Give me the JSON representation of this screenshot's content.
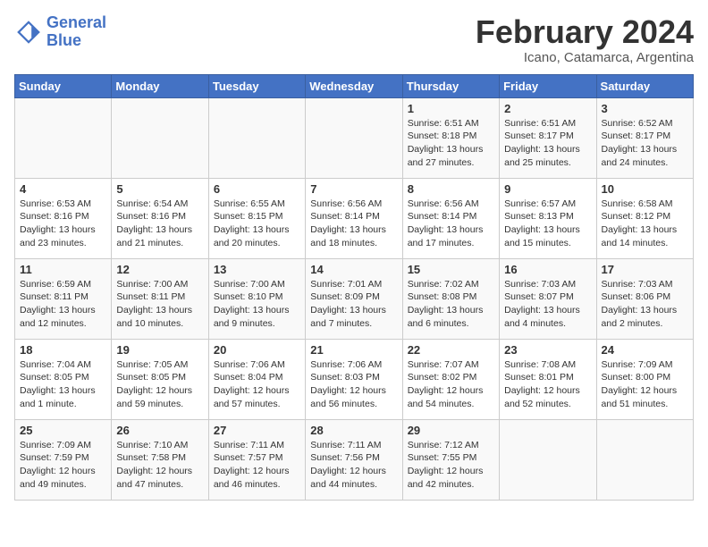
{
  "logo": {
    "line1": "General",
    "line2": "Blue"
  },
  "title": "February 2024",
  "subtitle": "Icano, Catamarca, Argentina",
  "days_of_week": [
    "Sunday",
    "Monday",
    "Tuesday",
    "Wednesday",
    "Thursday",
    "Friday",
    "Saturday"
  ],
  "weeks": [
    [
      {
        "day": "",
        "info": ""
      },
      {
        "day": "",
        "info": ""
      },
      {
        "day": "",
        "info": ""
      },
      {
        "day": "",
        "info": ""
      },
      {
        "day": "1",
        "info": "Sunrise: 6:51 AM\nSunset: 8:18 PM\nDaylight: 13 hours and 27 minutes."
      },
      {
        "day": "2",
        "info": "Sunrise: 6:51 AM\nSunset: 8:17 PM\nDaylight: 13 hours and 25 minutes."
      },
      {
        "day": "3",
        "info": "Sunrise: 6:52 AM\nSunset: 8:17 PM\nDaylight: 13 hours and 24 minutes."
      }
    ],
    [
      {
        "day": "4",
        "info": "Sunrise: 6:53 AM\nSunset: 8:16 PM\nDaylight: 13 hours and 23 minutes."
      },
      {
        "day": "5",
        "info": "Sunrise: 6:54 AM\nSunset: 8:16 PM\nDaylight: 13 hours and 21 minutes."
      },
      {
        "day": "6",
        "info": "Sunrise: 6:55 AM\nSunset: 8:15 PM\nDaylight: 13 hours and 20 minutes."
      },
      {
        "day": "7",
        "info": "Sunrise: 6:56 AM\nSunset: 8:14 PM\nDaylight: 13 hours and 18 minutes."
      },
      {
        "day": "8",
        "info": "Sunrise: 6:56 AM\nSunset: 8:14 PM\nDaylight: 13 hours and 17 minutes."
      },
      {
        "day": "9",
        "info": "Sunrise: 6:57 AM\nSunset: 8:13 PM\nDaylight: 13 hours and 15 minutes."
      },
      {
        "day": "10",
        "info": "Sunrise: 6:58 AM\nSunset: 8:12 PM\nDaylight: 13 hours and 14 minutes."
      }
    ],
    [
      {
        "day": "11",
        "info": "Sunrise: 6:59 AM\nSunset: 8:11 PM\nDaylight: 13 hours and 12 minutes."
      },
      {
        "day": "12",
        "info": "Sunrise: 7:00 AM\nSunset: 8:11 PM\nDaylight: 13 hours and 10 minutes."
      },
      {
        "day": "13",
        "info": "Sunrise: 7:00 AM\nSunset: 8:10 PM\nDaylight: 13 hours and 9 minutes."
      },
      {
        "day": "14",
        "info": "Sunrise: 7:01 AM\nSunset: 8:09 PM\nDaylight: 13 hours and 7 minutes."
      },
      {
        "day": "15",
        "info": "Sunrise: 7:02 AM\nSunset: 8:08 PM\nDaylight: 13 hours and 6 minutes."
      },
      {
        "day": "16",
        "info": "Sunrise: 7:03 AM\nSunset: 8:07 PM\nDaylight: 13 hours and 4 minutes."
      },
      {
        "day": "17",
        "info": "Sunrise: 7:03 AM\nSunset: 8:06 PM\nDaylight: 13 hours and 2 minutes."
      }
    ],
    [
      {
        "day": "18",
        "info": "Sunrise: 7:04 AM\nSunset: 8:05 PM\nDaylight: 13 hours and 1 minute."
      },
      {
        "day": "19",
        "info": "Sunrise: 7:05 AM\nSunset: 8:05 PM\nDaylight: 12 hours and 59 minutes."
      },
      {
        "day": "20",
        "info": "Sunrise: 7:06 AM\nSunset: 8:04 PM\nDaylight: 12 hours and 57 minutes."
      },
      {
        "day": "21",
        "info": "Sunrise: 7:06 AM\nSunset: 8:03 PM\nDaylight: 12 hours and 56 minutes."
      },
      {
        "day": "22",
        "info": "Sunrise: 7:07 AM\nSunset: 8:02 PM\nDaylight: 12 hours and 54 minutes."
      },
      {
        "day": "23",
        "info": "Sunrise: 7:08 AM\nSunset: 8:01 PM\nDaylight: 12 hours and 52 minutes."
      },
      {
        "day": "24",
        "info": "Sunrise: 7:09 AM\nSunset: 8:00 PM\nDaylight: 12 hours and 51 minutes."
      }
    ],
    [
      {
        "day": "25",
        "info": "Sunrise: 7:09 AM\nSunset: 7:59 PM\nDaylight: 12 hours and 49 minutes."
      },
      {
        "day": "26",
        "info": "Sunrise: 7:10 AM\nSunset: 7:58 PM\nDaylight: 12 hours and 47 minutes."
      },
      {
        "day": "27",
        "info": "Sunrise: 7:11 AM\nSunset: 7:57 PM\nDaylight: 12 hours and 46 minutes."
      },
      {
        "day": "28",
        "info": "Sunrise: 7:11 AM\nSunset: 7:56 PM\nDaylight: 12 hours and 44 minutes."
      },
      {
        "day": "29",
        "info": "Sunrise: 7:12 AM\nSunset: 7:55 PM\nDaylight: 12 hours and 42 minutes."
      },
      {
        "day": "",
        "info": ""
      },
      {
        "day": "",
        "info": ""
      }
    ]
  ]
}
